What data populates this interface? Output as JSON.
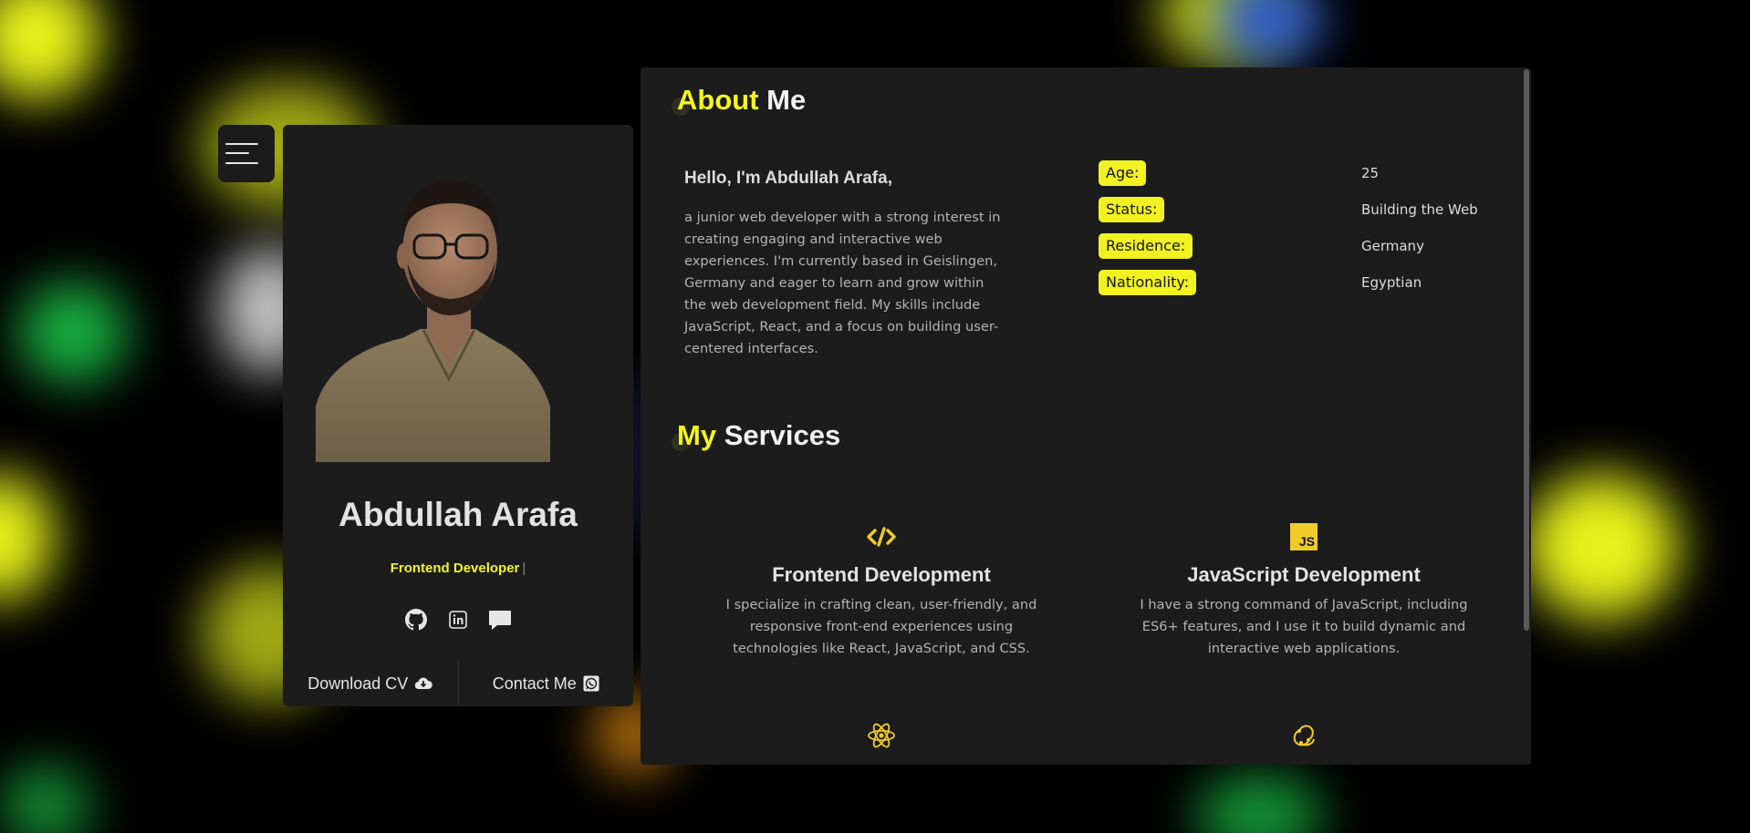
{
  "colors": {
    "accent": "#f5f51f",
    "panel": "#1c1c1c",
    "background": "#000000",
    "icon_gold": "#f0cc2a"
  },
  "menu": {
    "icon": "hamburger-menu-icon"
  },
  "profile": {
    "photo_alt": "Abdullah Arafa",
    "name": "Abdullah Arafa",
    "role": "Frontend Developer",
    "role_cursor": "|",
    "socials": [
      {
        "icon": "github-icon"
      },
      {
        "icon": "linkedin-icon"
      },
      {
        "icon": "chat-icon"
      }
    ],
    "download_cv_label": "Download CV",
    "download_icon": "cloud-download-icon",
    "contact_label": "Contact Me",
    "contact_icon": "whatsapp-icon"
  },
  "about": {
    "title_accent": "About",
    "title_rest": "Me",
    "greeting": "Hello, I'm Abdullah Arafa,",
    "bio": "a junior web developer with a strong interest in creating engaging and interactive web experiences. I'm currently based in Geislingen, Germany and eager to learn and grow within the web development field. My skills include JavaScript, React, and a focus on building user-centered interfaces.",
    "info": [
      {
        "label": "Age:",
        "value": "25"
      },
      {
        "label": "Status:",
        "value": "Building the Web"
      },
      {
        "label": "Residence:",
        "value": "Germany"
      },
      {
        "label": "Nationality:",
        "value": "Egyptian"
      }
    ]
  },
  "services": {
    "title_accent": "My",
    "title_rest": "Services",
    "items": [
      {
        "icon": "code-icon",
        "title": "Frontend Development",
        "description": "I specialize in crafting clean, user-friendly, and responsive front-end experiences using technologies like React, JavaScript, and CSS."
      },
      {
        "icon": "javascript-icon",
        "badge": "JS",
        "title": "JavaScript Development",
        "description": "I have a strong command of JavaScript, including ES6+ features, and I use it to build dynamic and interactive web applications."
      },
      {
        "icon": "react-icon"
      },
      {
        "icon": "redux-icon"
      }
    ]
  }
}
